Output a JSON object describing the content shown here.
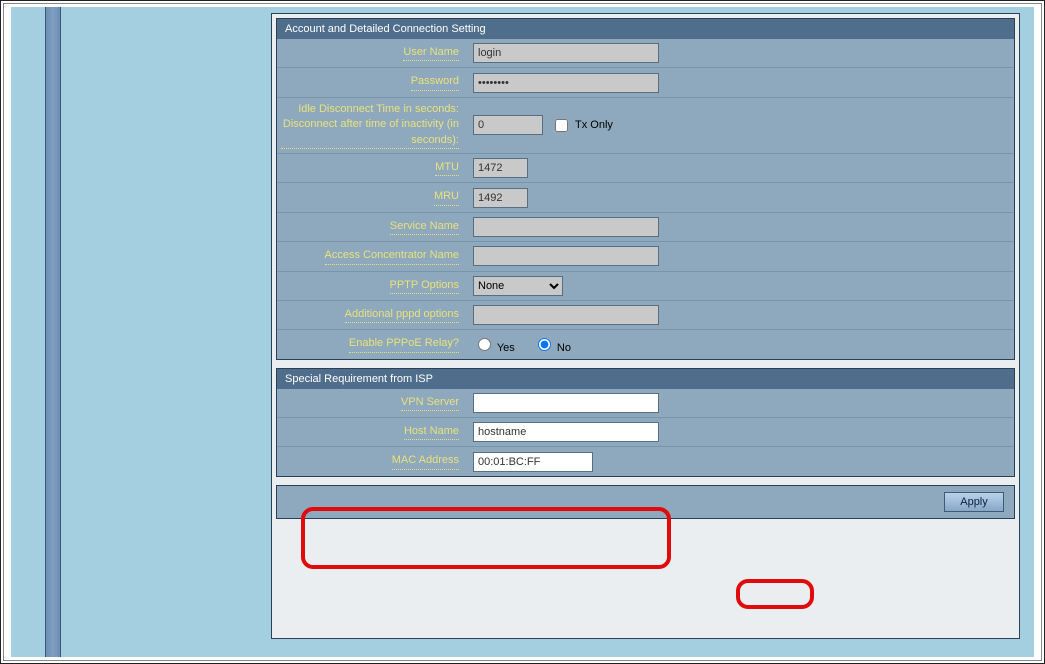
{
  "account_section": {
    "title": "Account and Detailed Connection Setting",
    "user_name_label": "User Name",
    "user_name_value": "login",
    "password_label": "Password",
    "password_value": "••••••••",
    "idle_label": "Idle Disconnect Time in seconds: Disconnect after time of inactivity (in seconds):",
    "idle_value": "0",
    "tx_only_label": "Tx Only",
    "mtu_label": "MTU",
    "mtu_value": "1472",
    "mru_label": "MRU",
    "mru_value": "1492",
    "service_name_label": "Service Name",
    "service_name_value": "",
    "ac_name_label": "Access Concentrator Name",
    "ac_name_value": "",
    "pptp_options_label": "PPTP Options",
    "pptp_options_value": "None",
    "pppd_options_label": "Additional pppd options",
    "pppd_options_value": "",
    "pppoe_relay_label": "Enable PPPoE Relay?",
    "yes_label": "Yes",
    "no_label": "No"
  },
  "isp_section": {
    "title": "Special Requirement from ISP",
    "vpn_server_label": "VPN Server",
    "vpn_server_value": "",
    "host_name_label": "Host Name",
    "host_name_value": "hostname",
    "mac_address_label": "MAC Address",
    "mac_address_value": "00:01:BC:FF"
  },
  "apply_label": "Apply"
}
